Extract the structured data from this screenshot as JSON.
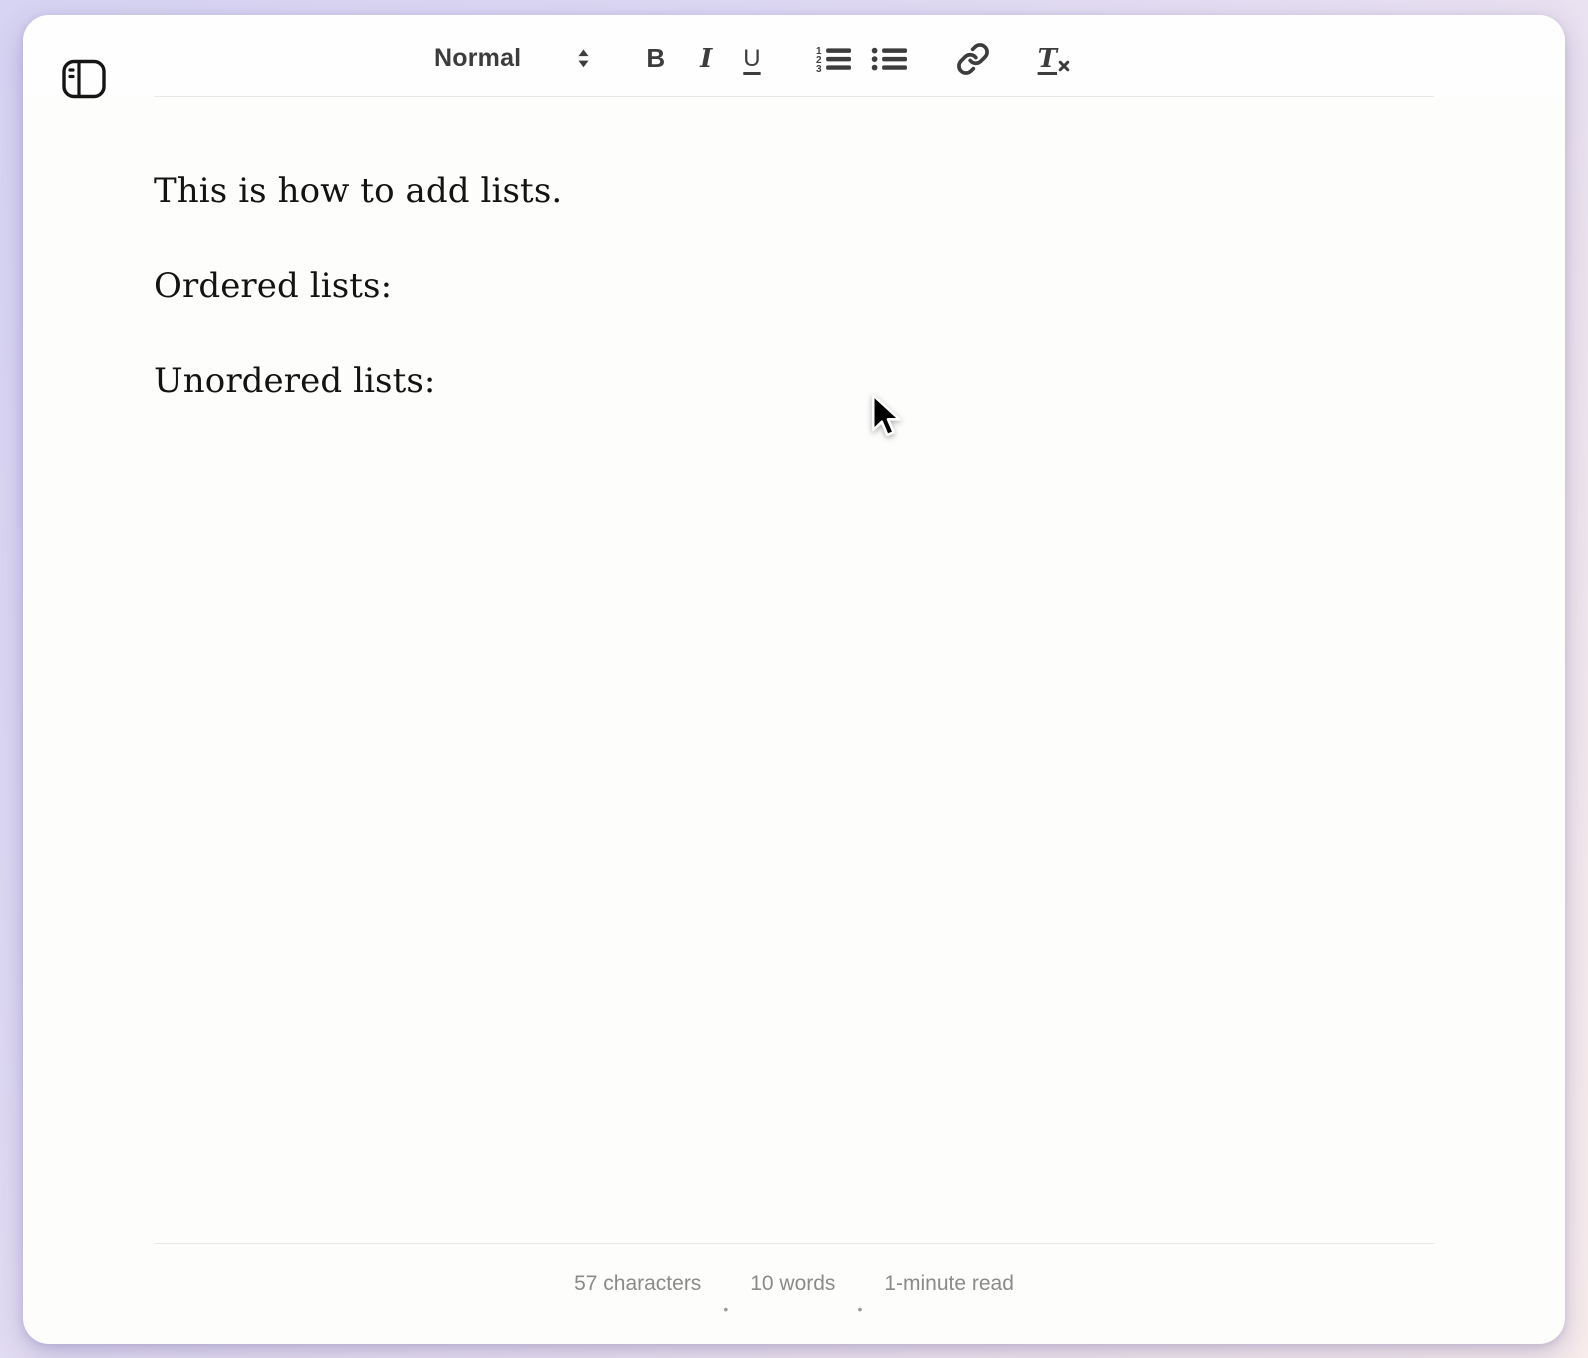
{
  "colors": {
    "frame_gradient_start": "#d7d3f2",
    "frame_gradient_end": "#f8ecec",
    "card_background": "#fdfdfc",
    "toolbar_icon": "#3d3d3d",
    "divider": "#e9e8e4",
    "body_text": "#131313",
    "footer_text": "#8a8a8a"
  },
  "sidebar_toggle": {
    "icon": "sidebar-toggle-icon"
  },
  "toolbar": {
    "style_selector": {
      "value": "Normal",
      "icon": "chevron-up-down-icon"
    },
    "bold_label": "B",
    "italic_label": "I",
    "underline_label": "U",
    "clear_format_t": "T",
    "ordered_list_numbers": [
      "1",
      "2",
      "3"
    ],
    "icons": [
      "ordered-list-icon",
      "bullet-list-icon",
      "link-icon",
      "clear-formatting-icon"
    ]
  },
  "editor": {
    "paragraphs": [
      "This is how to add lists.",
      "Ordered lists:",
      "Unordered lists:"
    ]
  },
  "footer": {
    "characters": "57 characters",
    "separator1": "•",
    "words": "10 words",
    "separator2": "•",
    "read_time": "1-minute read"
  }
}
